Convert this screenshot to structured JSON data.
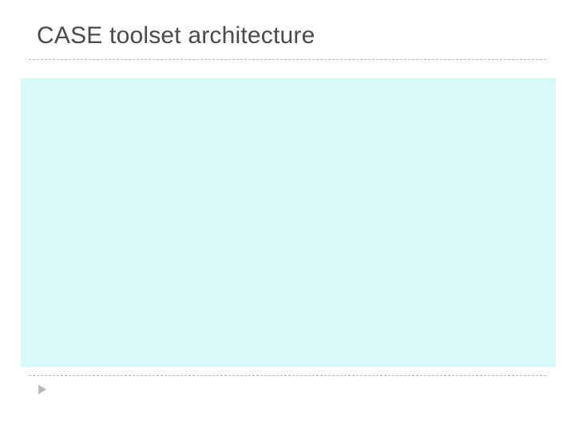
{
  "slide": {
    "title": "CASE toolset architecture"
  }
}
